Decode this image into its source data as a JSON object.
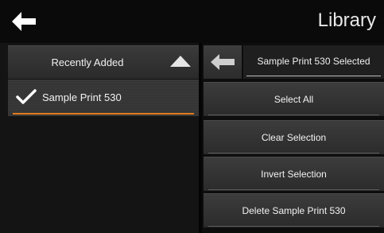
{
  "header": {
    "title": "Library",
    "back_icon": "arrow-left-icon"
  },
  "left": {
    "sort_label": "Recently Added",
    "sort_icon": "caret-up-icon",
    "items": [
      {
        "label": "Sample Print 530",
        "checked": true,
        "check_icon": "checkmark-icon"
      }
    ]
  },
  "right": {
    "back_icon": "arrow-left-icon",
    "selection_text": "Sample Print 530 Selected",
    "actions": {
      "select_all": "Select All",
      "clear_selection": "Clear Selection",
      "invert_selection": "Invert Selection",
      "delete": "Delete Sample Print 530"
    }
  },
  "colors": {
    "accent": "#e07a1a",
    "background": "#000000",
    "text": "#ffffff"
  }
}
